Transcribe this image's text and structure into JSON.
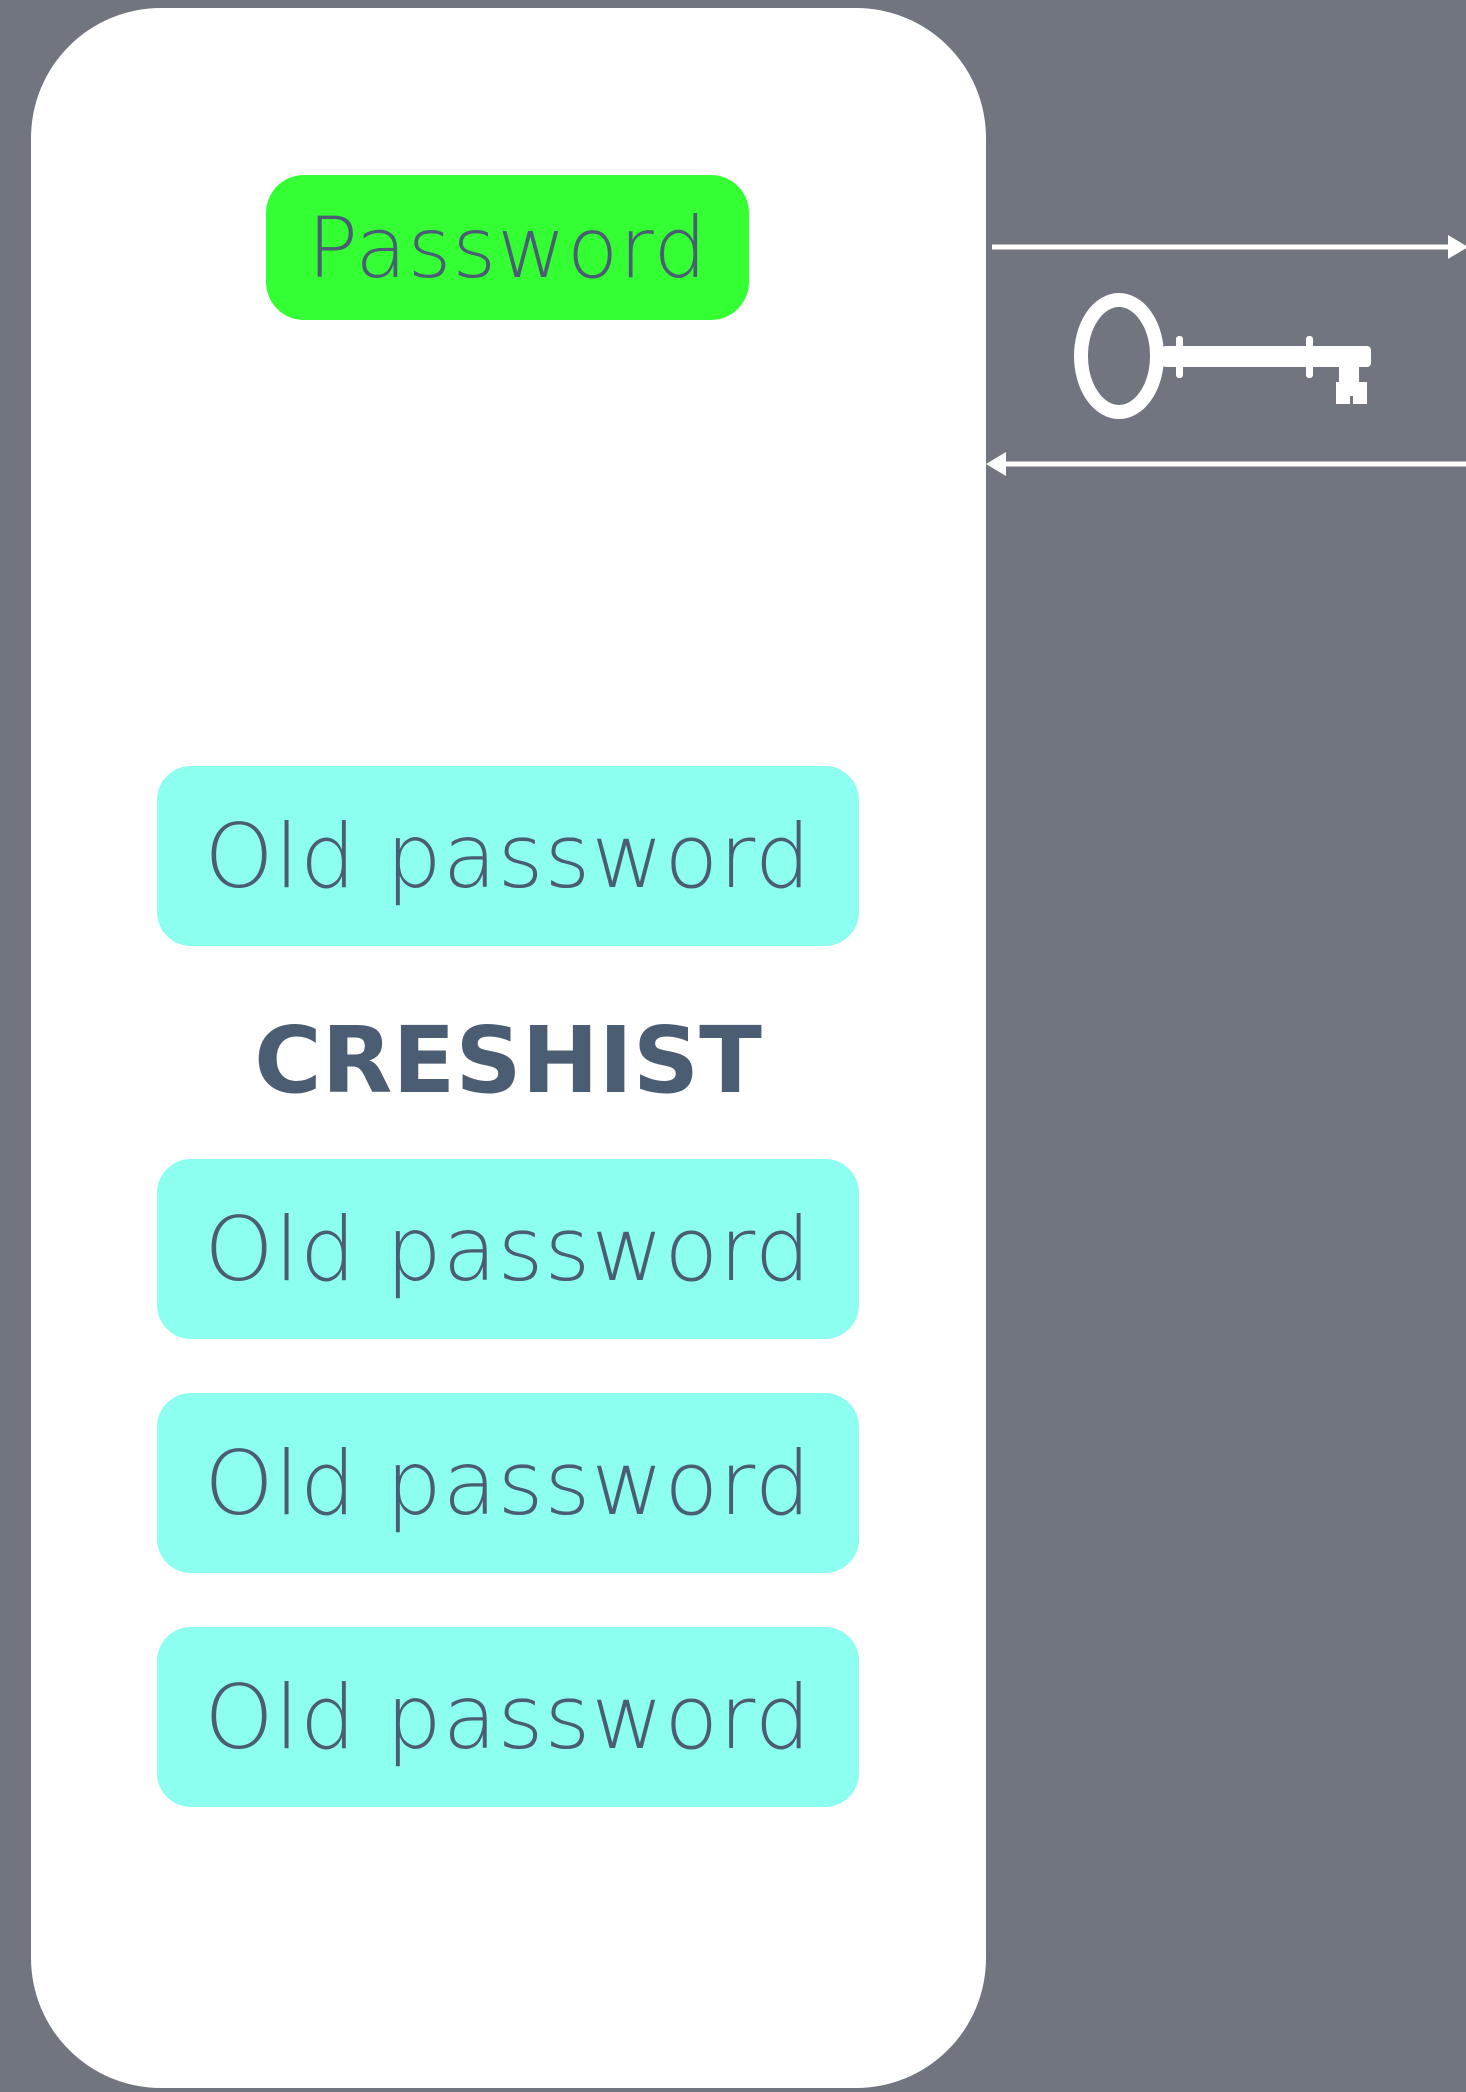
{
  "colors": {
    "background": "#717580",
    "panel": "#ffffff",
    "password_fill": "#33ff33",
    "old_password_fill": "#8cfff0",
    "text": "#4a5d73",
    "arrow": "#ffffff"
  },
  "password_box": {
    "label": "Password"
  },
  "history_label": "CRESHIST",
  "old_passwords": [
    {
      "label": "Old password"
    },
    {
      "label": "Old password"
    },
    {
      "label": "Old password"
    },
    {
      "label": "Old password"
    }
  ],
  "icons": {
    "key": "key-icon",
    "outgoing_arrow": "arrow-right-icon",
    "incoming_arrow": "arrow-left-icon"
  }
}
